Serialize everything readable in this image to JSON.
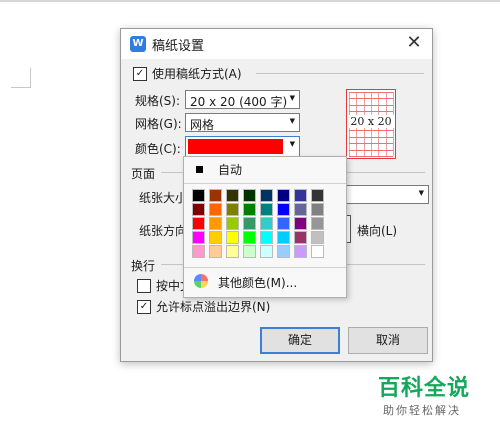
{
  "dialog": {
    "title": "稿纸设置",
    "use_grid_paper": {
      "label": "使用稿纸方式(A)",
      "checked": true
    },
    "spec": {
      "label": "规格(S):",
      "value": "20 x 20 (400 字)"
    },
    "grid": {
      "label": "网格(G):",
      "value": "网格"
    },
    "color": {
      "label": "颜色(C):",
      "value": "#ff0000"
    },
    "preview_text": "20 x 20",
    "page_section": "页面",
    "paper_size": {
      "label": "纸张大小",
      "value": ""
    },
    "paper_orient": {
      "label": "纸张方向",
      "landscape": "横向(L)"
    },
    "wrap_section": "换行",
    "wrap_option1": {
      "label": "按中文",
      "checked": false
    },
    "wrap_option2": {
      "label": "允许标点溢出边界(N)",
      "checked": true
    },
    "ok_label": "确定",
    "cancel_label": "取消"
  },
  "color_popup": {
    "auto_label": "自动",
    "other_label": "其他颜色(M)...",
    "swatches": [
      "#000000",
      "#993300",
      "#333300",
      "#003300",
      "#003366",
      "#000080",
      "#333399",
      "#333333",
      "#800000",
      "#ff6600",
      "#808000",
      "#008000",
      "#008080",
      "#0000ff",
      "#666699",
      "#808080",
      "#ff0000",
      "#ff9900",
      "#99cc00",
      "#339966",
      "#33cccc",
      "#3366ff",
      "#800080",
      "#969696",
      "#ff00ff",
      "#ffcc00",
      "#ffff00",
      "#00ff00",
      "#00ffff",
      "#00ccff",
      "#993366",
      "#c0c0c0",
      "#ff99cc",
      "#ffcc99",
      "#ffff99",
      "#ccffcc",
      "#ccffff",
      "#99ccff",
      "#cc99ff",
      "#ffffff"
    ]
  },
  "watermark": {
    "brand": "百科全说",
    "slogan": "助你轻松解决"
  }
}
